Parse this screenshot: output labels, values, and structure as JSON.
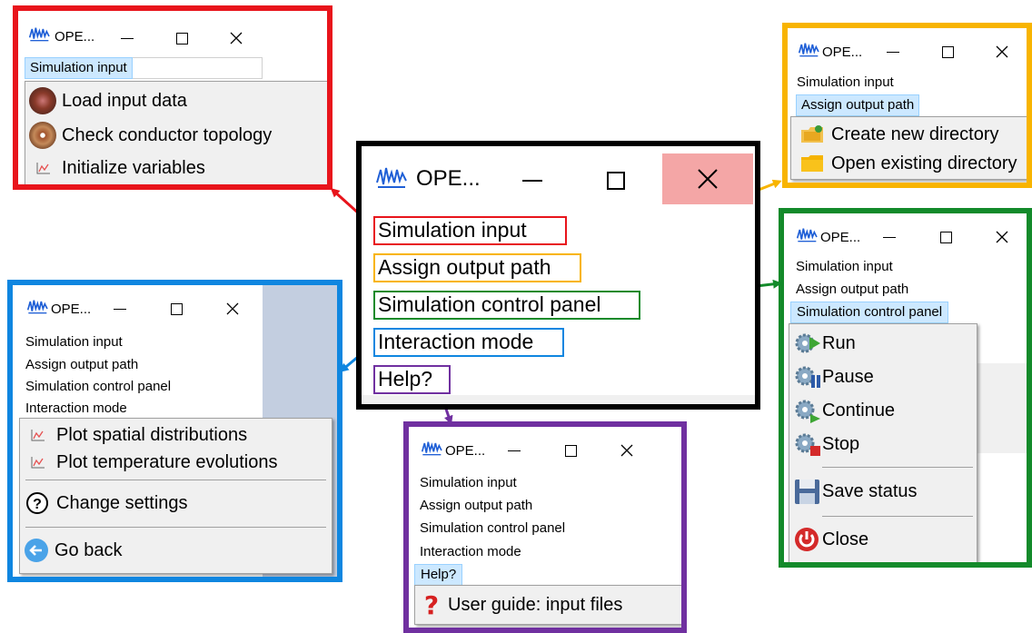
{
  "app": {
    "window_title": "OPE..."
  },
  "menu": {
    "simulation_input": "Simulation input",
    "assign_output_path": "Assign output path",
    "simulation_control_panel": "Simulation control panel",
    "interaction_mode": "Interaction mode",
    "help": "Help?"
  },
  "simulation_input_menu": [
    "Load input data",
    "Check conductor topology",
    "Initialize variables"
  ],
  "assign_output_path_menu": [
    "Create new directory",
    "Open existing directory"
  ],
  "simulation_control_menu": [
    "Run",
    "Pause",
    "Continue",
    "Stop",
    "Save status",
    "Close"
  ],
  "interaction_mode_menu": [
    "Plot spatial distributions",
    "Plot temperature evolutions",
    "Change settings",
    "Go back"
  ],
  "help_menu": [
    "User guide: input files"
  ],
  "colors": {
    "simulation_input": "#e8141b",
    "assign_output_path": "#f8b400",
    "simulation_control_panel": "#138a2a",
    "interaction_mode": "#0f86e0",
    "help": "#7030a0",
    "main_frame": "#000000",
    "close_hover": "#f4a6a6",
    "selection": "#cce8ff"
  }
}
